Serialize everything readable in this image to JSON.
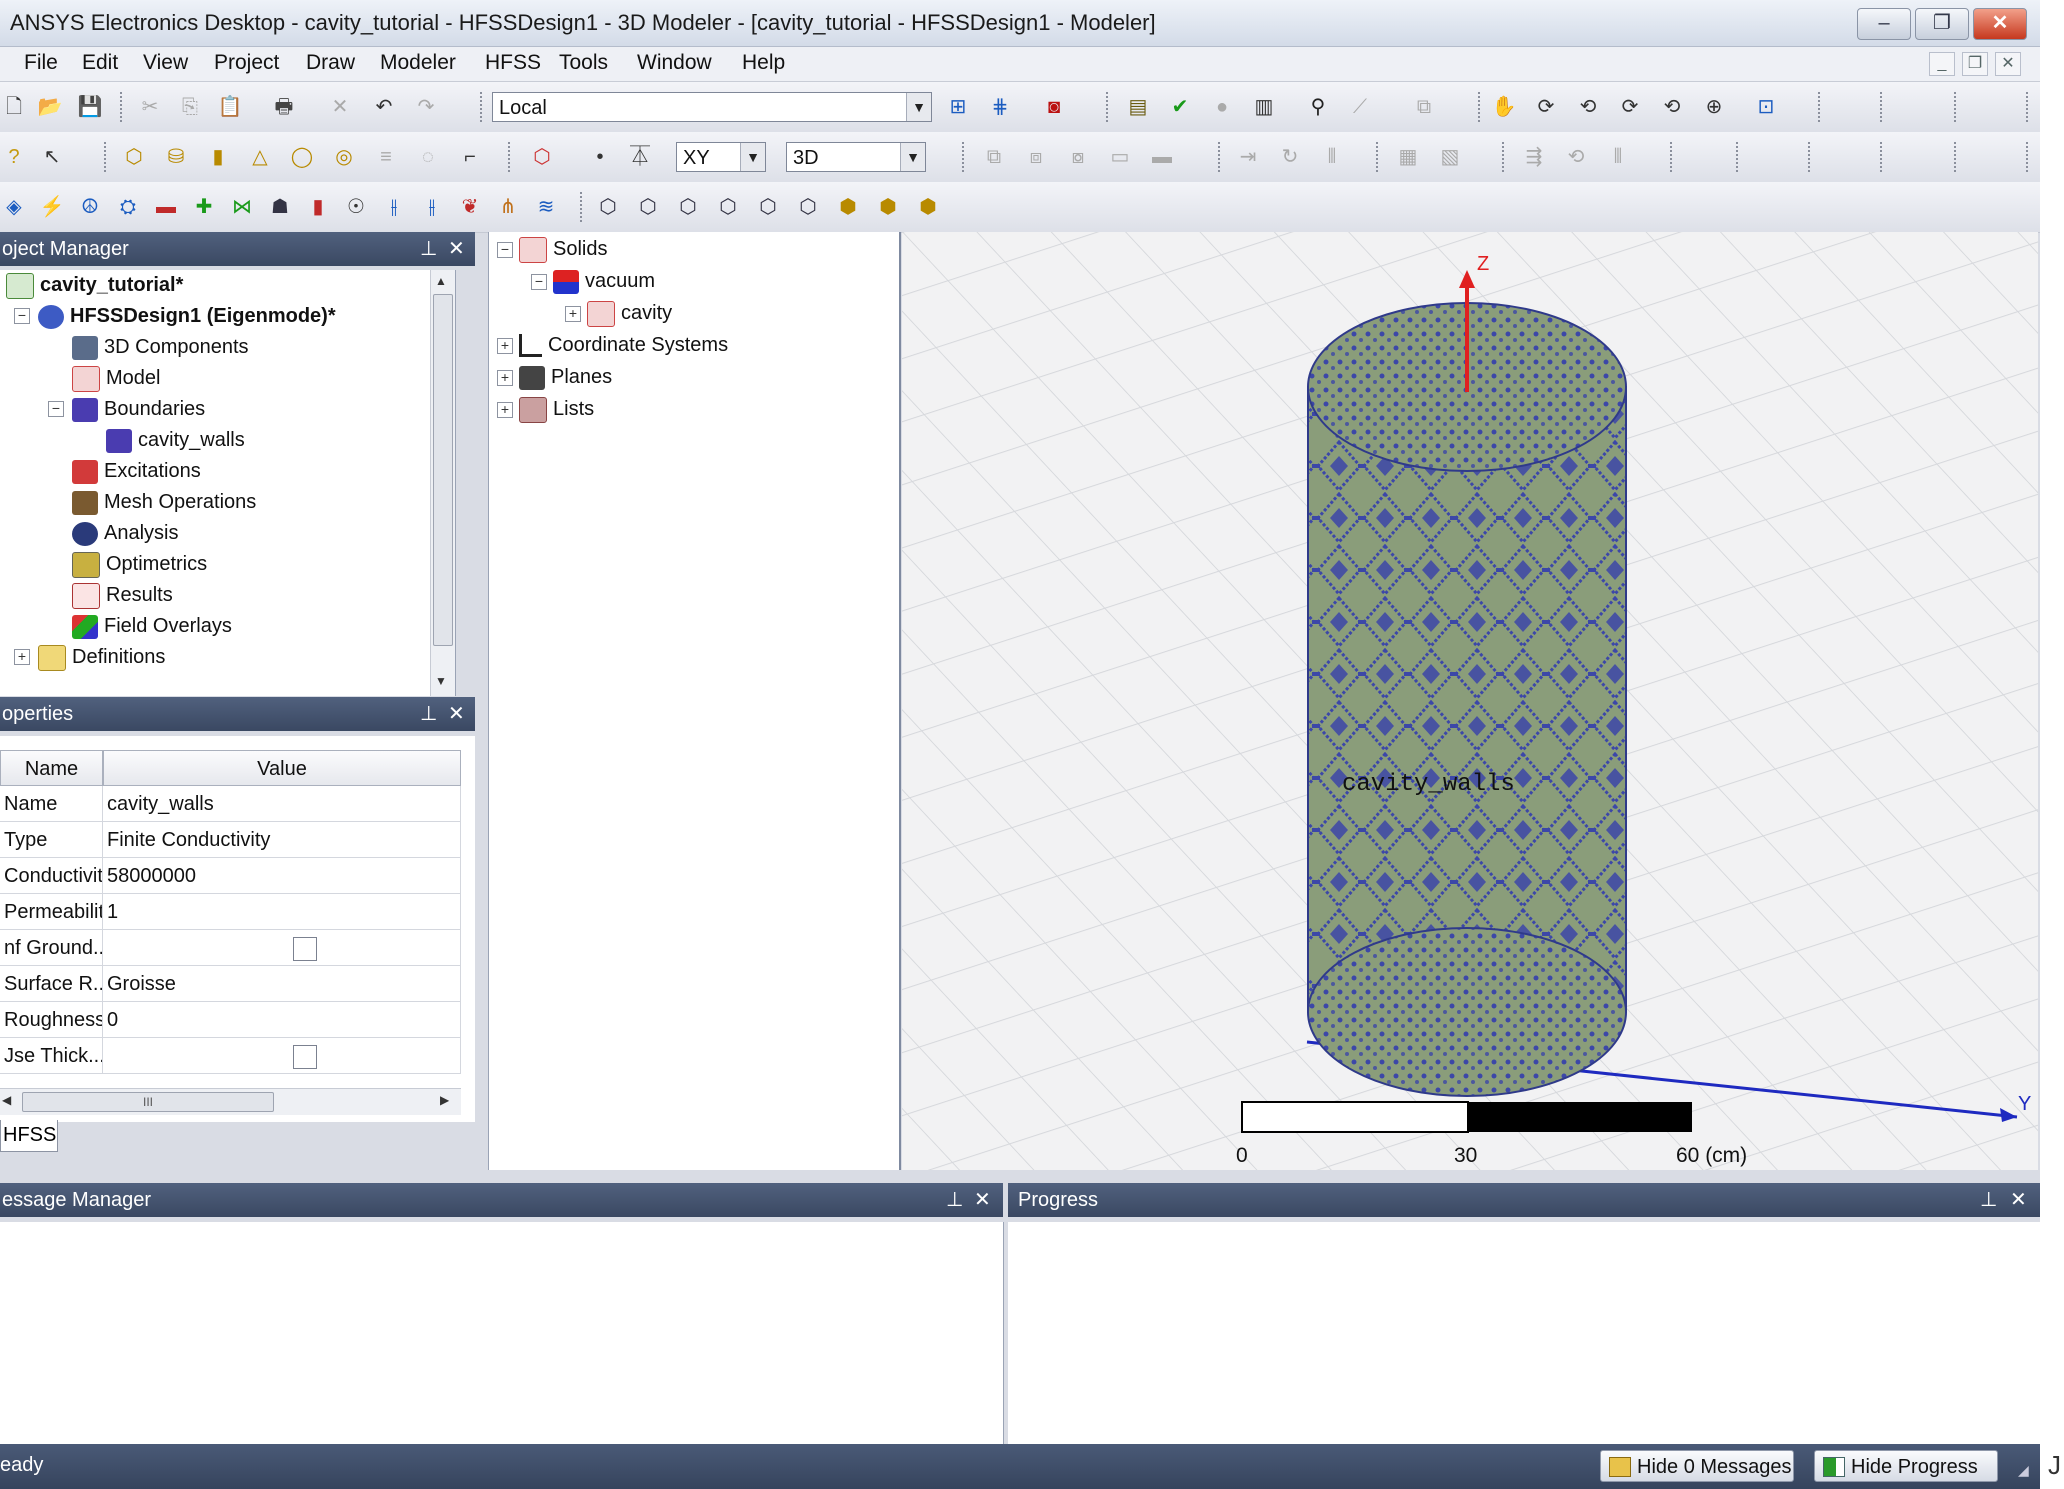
{
  "window": {
    "title": "ANSYS Electronics Desktop - cavity_tutorial - HFSSDesign1 - 3D Modeler - [cavity_tutorial - HFSSDesign1 - Modeler]",
    "minimize": "–",
    "restore": "❐",
    "close": "✕"
  },
  "menu": [
    "File",
    "Edit",
    "View",
    "Project",
    "Draw",
    "Modeler",
    "HFSS",
    "Tools",
    "Window",
    "Help"
  ],
  "toolbar": {
    "coord_system": "Local",
    "plane": "XY",
    "view_mode": "3D"
  },
  "project_manager": {
    "header": "oject Manager",
    "pin": "⊥",
    "close": "✕",
    "tree": [
      {
        "label": "cavity_tutorial*"
      },
      {
        "label": "HFSSDesign1 (Eigenmode)*"
      },
      {
        "label": "3D Components"
      },
      {
        "label": "Model"
      },
      {
        "label": "Boundaries"
      },
      {
        "label": "cavity_walls"
      },
      {
        "label": "Excitations"
      },
      {
        "label": "Mesh Operations"
      },
      {
        "label": "Analysis"
      },
      {
        "label": "Optimetrics"
      },
      {
        "label": "Results"
      },
      {
        "label": "Field Overlays"
      },
      {
        "label": "Definitions"
      }
    ]
  },
  "properties": {
    "header": "operties",
    "col_name": "Name",
    "col_value": "Value",
    "rows": [
      {
        "name": "Name",
        "value": "cavity_walls"
      },
      {
        "name": "Type",
        "value": "Finite Conductivity"
      },
      {
        "name": "Conductivity",
        "value": "58000000"
      },
      {
        "name": "Permeability",
        "value": "1"
      },
      {
        "name": "nf Ground...",
        "value": ""
      },
      {
        "name": "Surface R...",
        "value": "Groisse"
      },
      {
        "name": "Roughness",
        "value": "0"
      },
      {
        "name": "Jse Thick...",
        "value": ""
      }
    ],
    "hscroll_grip": "III",
    "tab": "HFSS"
  },
  "model_tree": [
    {
      "label": "Solids"
    },
    {
      "label": "vacuum"
    },
    {
      "label": "cavity"
    },
    {
      "label": "Coordinate Systems"
    },
    {
      "label": "Planes"
    },
    {
      "label": "Lists"
    }
  ],
  "viewport": {
    "object_label": "cavity_walls",
    "axis_z": "Z",
    "axis_y": "Y",
    "scale": {
      "zero": "0",
      "mid": "30",
      "end": "60 (cm)"
    }
  },
  "message_manager": {
    "header": "essage Manager"
  },
  "progress": {
    "header": "Progress"
  },
  "status": {
    "text": "eady",
    "hide_messages": "Hide 0 Messages",
    "hide_progress": "Hide Progress",
    "corner": "J"
  },
  "colors": {
    "panel_header": "#44536e",
    "cylinder_body": "#8a9d7a",
    "pattern": "#3c47a8",
    "axis_z": "#e02020",
    "axis_y": "#1e2ac0"
  }
}
